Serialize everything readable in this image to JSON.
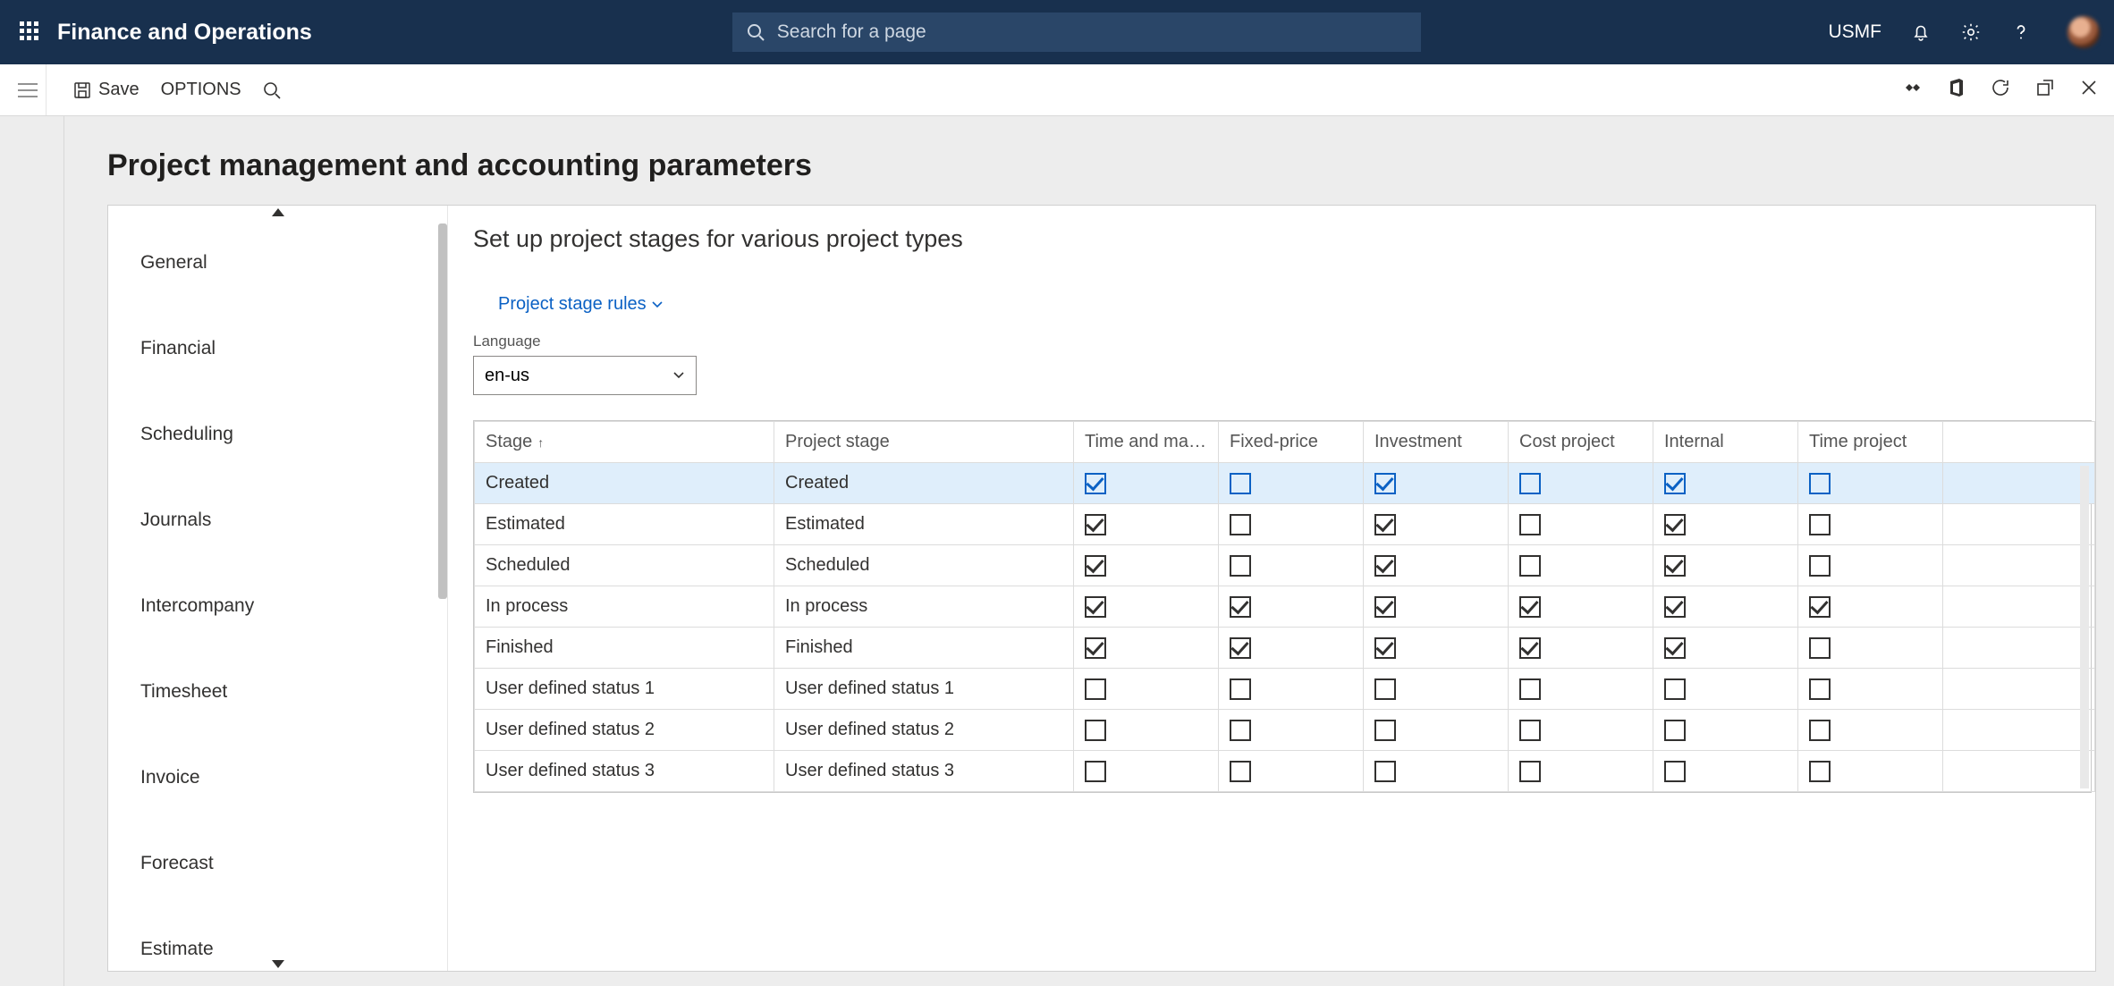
{
  "header": {
    "app_title": "Finance and Operations",
    "search_placeholder": "Search for a page",
    "company": "USMF"
  },
  "actionbar": {
    "save_label": "Save",
    "options_label": "OPTIONS"
  },
  "page": {
    "title": "Project management and accounting parameters"
  },
  "sidenav": {
    "items": [
      {
        "label": "General"
      },
      {
        "label": "Financial"
      },
      {
        "label": "Scheduling"
      },
      {
        "label": "Journals"
      },
      {
        "label": "Intercompany"
      },
      {
        "label": "Timesheet"
      },
      {
        "label": "Invoice"
      },
      {
        "label": "Forecast"
      },
      {
        "label": "Estimate"
      }
    ]
  },
  "content": {
    "title": "Set up project stages for various project types",
    "rules_link": "Project stage rules",
    "language_label": "Language",
    "language_value": "en-us"
  },
  "table": {
    "columns": [
      {
        "key": "stage",
        "label": "Stage",
        "sort": "asc"
      },
      {
        "key": "project_stage",
        "label": "Project stage"
      },
      {
        "key": "tm",
        "label": "Time and materi..."
      },
      {
        "key": "fp",
        "label": "Fixed-price"
      },
      {
        "key": "inv",
        "label": "Investment"
      },
      {
        "key": "cost",
        "label": "Cost project"
      },
      {
        "key": "int",
        "label": "Internal"
      },
      {
        "key": "time",
        "label": "Time project"
      }
    ],
    "rows": [
      {
        "stage": "Created",
        "project_stage": "Created",
        "tm": true,
        "fp": false,
        "inv": true,
        "cost": false,
        "int": true,
        "time": false,
        "selected": true
      },
      {
        "stage": "Estimated",
        "project_stage": "Estimated",
        "tm": true,
        "fp": false,
        "inv": true,
        "cost": false,
        "int": true,
        "time": false
      },
      {
        "stage": "Scheduled",
        "project_stage": "Scheduled",
        "tm": true,
        "fp": false,
        "inv": true,
        "cost": false,
        "int": true,
        "time": false
      },
      {
        "stage": "In process",
        "project_stage": "In process",
        "tm": true,
        "fp": true,
        "inv": true,
        "cost": true,
        "int": true,
        "time": true
      },
      {
        "stage": "Finished",
        "project_stage": "Finished",
        "tm": true,
        "fp": true,
        "inv": true,
        "cost": true,
        "int": true,
        "time": false
      },
      {
        "stage": "User defined status 1",
        "project_stage": "User defined status 1",
        "tm": false,
        "fp": false,
        "inv": false,
        "cost": false,
        "int": false,
        "time": false
      },
      {
        "stage": "User defined status 2",
        "project_stage": "User defined status 2",
        "tm": false,
        "fp": false,
        "inv": false,
        "cost": false,
        "int": false,
        "time": false
      },
      {
        "stage": "User defined status 3",
        "project_stage": "User defined status 3",
        "tm": false,
        "fp": false,
        "inv": false,
        "cost": false,
        "int": false,
        "time": false
      }
    ]
  }
}
